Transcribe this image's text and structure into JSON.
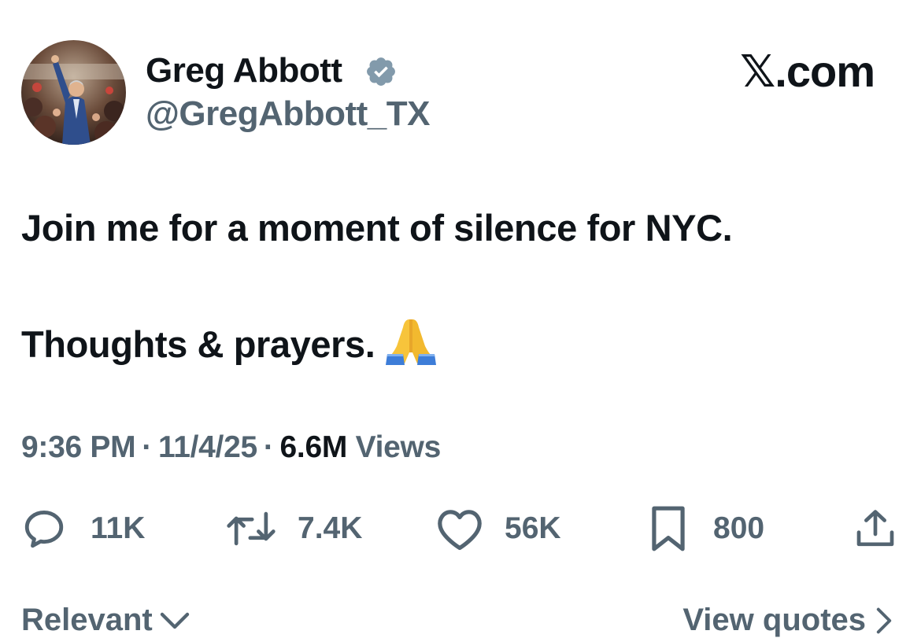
{
  "header": {
    "display_name": "Greg Abbott",
    "handle": "@GregAbbott_TX",
    "brand": "𝕏.com",
    "verified": true,
    "avatar_icon": "profile-photo"
  },
  "tweet": {
    "line1": "Join me for a moment of silence for NYC.",
    "line2": "Thoughts & prayers.",
    "emoji": "folded-hands-icon"
  },
  "meta": {
    "time": "9:36 PM",
    "date": "11/4/25",
    "views_count": "6.6M",
    "views_label": "Views",
    "separator": "·"
  },
  "actions": {
    "replies": "11K",
    "reposts": "7.4K",
    "likes": "56K",
    "bookmarks": "800"
  },
  "footer": {
    "sort_label": "Relevant",
    "quotes_label": "View quotes"
  },
  "colors": {
    "text": "#0f1419",
    "secondary": "#536471",
    "verified": "#829aab"
  }
}
